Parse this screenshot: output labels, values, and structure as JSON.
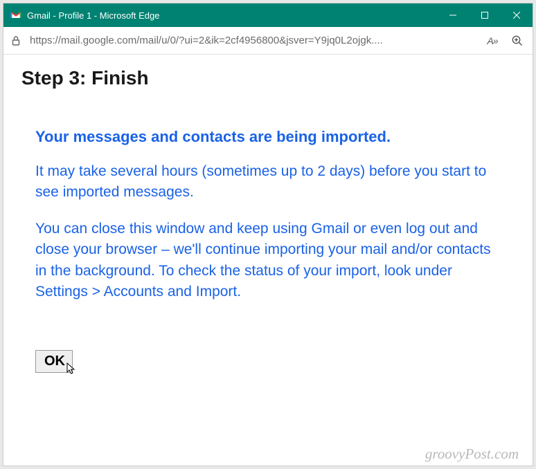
{
  "titlebar": {
    "title": "Gmail - Profile 1 - Microsoft Edge"
  },
  "addrbar": {
    "url": "https://mail.google.com/mail/u/0/?ui=2&ik=2cf4956800&jsver=Y9jq0L2ojgk....",
    "reader_label": "A»"
  },
  "page": {
    "step_title": "Step 3: Finish",
    "heading": "Your messages and contacts are being imported.",
    "p1": "It may take several hours (sometimes up to 2 days) before you start to see imported messages.",
    "p2": "You can close this window and keep using Gmail or even log out and close your browser – we'll continue importing your mail and/or contacts in the background. To check the status of your import, look under Settings > Accounts and Import.",
    "ok_label": "OK"
  },
  "watermark": "groovyPost.com"
}
